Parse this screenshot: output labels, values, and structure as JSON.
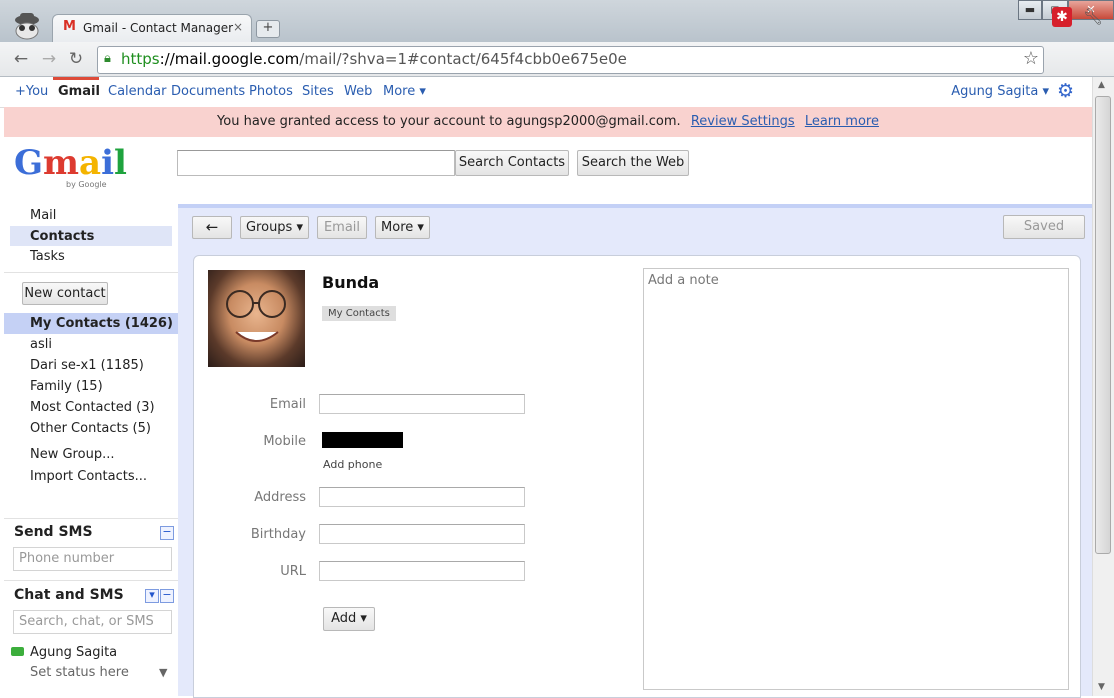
{
  "browser": {
    "tab_title": "Gmail - Contact Manager",
    "tab_close": "×",
    "new_tab": "+",
    "url_scheme": "https",
    "url_host": "://mail.google.com",
    "url_path": "/mail/?shva=1#contact/645f4cbb0e675e0e",
    "window_min": "▬",
    "window_max": "◻",
    "window_close": "✕"
  },
  "gbar": {
    "items": [
      "+You",
      "Gmail",
      "Calendar",
      "Documents",
      "Photos",
      "Sites",
      "Web",
      "More ▾"
    ],
    "active_index": 1,
    "user": "Agung Sagita ▾"
  },
  "notice": {
    "text": "You have granted access to your account to agungsp2000@gmail.com.",
    "review": "Review Settings",
    "learn": "Learn more"
  },
  "logo": {
    "text": "Gmail",
    "by": "by Google"
  },
  "search": {
    "value": "",
    "contacts_btn": "Search Contacts",
    "web_btn": "Search the Web"
  },
  "sidebar": {
    "nav": [
      "Mail",
      "Contacts",
      "Tasks"
    ],
    "new_contact": "New contact",
    "groups": [
      "My Contacts (1426)",
      "asli",
      "Dari se-x1 (1185)",
      "Family (15)",
      "Most Contacted (3)",
      "Other Contacts (5)"
    ],
    "new_group": "New Group...",
    "import": "Import Contacts...",
    "sms_title": "Send SMS",
    "sms_placeholder": "Phone number",
    "chat_title": "Chat and SMS",
    "chat_placeholder": "Search, chat, or SMS",
    "chat_user": "Agung Sagita",
    "chat_status": "Set status here"
  },
  "toolbar": {
    "back": "←",
    "groups": "Groups ▾",
    "email": "Email",
    "more": "More ▾",
    "saved": "Saved"
  },
  "contact": {
    "name": "Bunda",
    "group_tag": "My Contacts",
    "fields": {
      "email": "Email",
      "mobile": "Mobile",
      "add_phone": "Add phone",
      "address": "Address",
      "birthday": "Birthday",
      "url": "URL"
    },
    "add_btn": "Add ▾",
    "note_placeholder": "Add a note"
  }
}
